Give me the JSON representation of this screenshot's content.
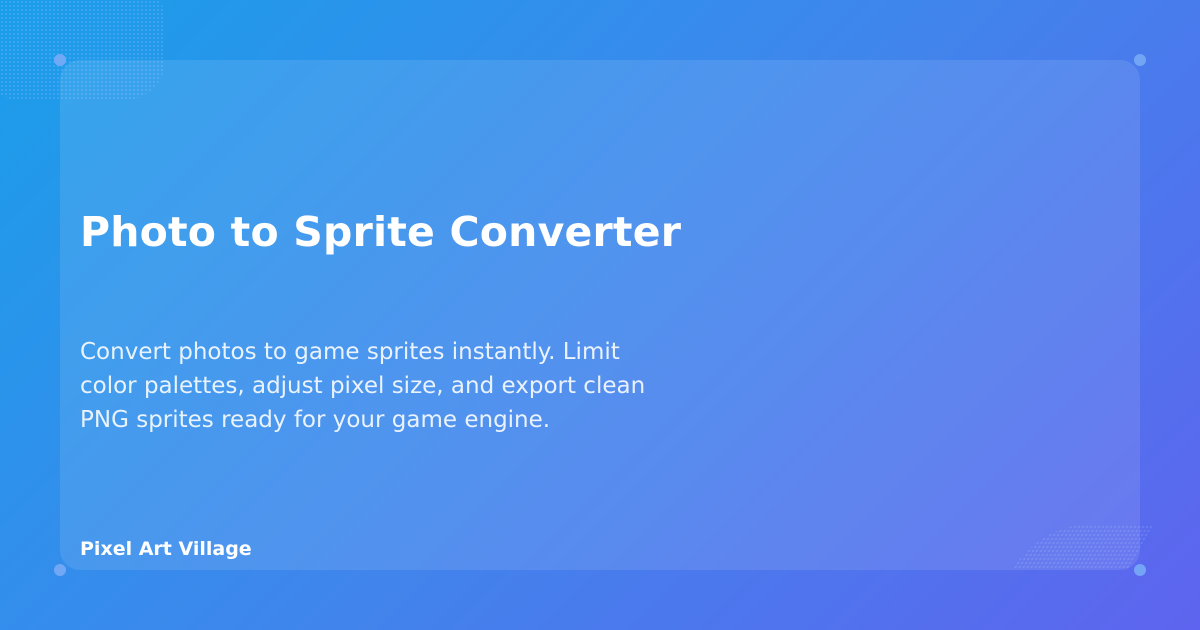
{
  "title": "Photo to Sprite Converter",
  "description": "Convert photos to game sprites instantly. Limit color palettes, adjust pixel size, and export clean PNG sprites ready for your game engine.",
  "brand": "Pixel Art Village",
  "colors": {
    "gradient_start": "#1a9eea",
    "gradient_end": "#5e64ef"
  }
}
